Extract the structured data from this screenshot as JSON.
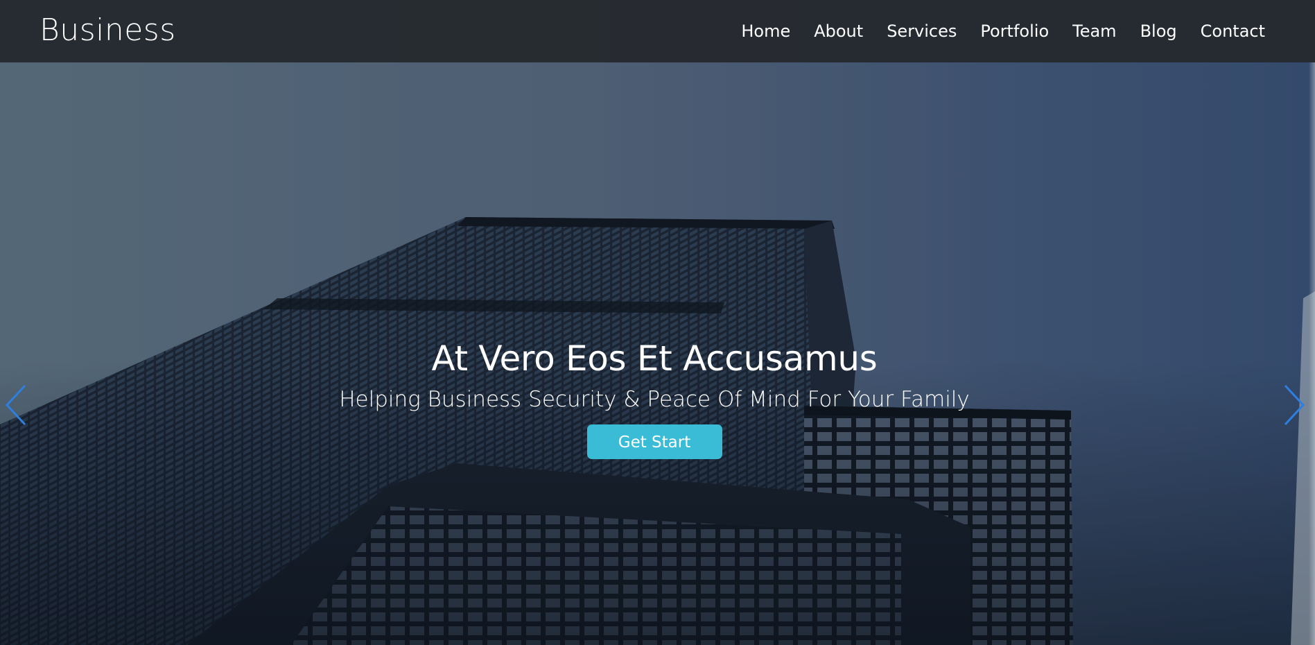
{
  "nav": {
    "brand": "Business",
    "links": [
      "Home",
      "About",
      "Services",
      "Portfolio",
      "Team",
      "Blog",
      "Contact"
    ]
  },
  "hero": {
    "title": "At Vero Eos Et Accusamus",
    "subtitle": "Helping Business Security & Peace Of Mind For Your Family",
    "cta_label": "Get Start"
  },
  "icons": {
    "prev": "chevron-left-icon",
    "next": "chevron-right-icon"
  },
  "colors": {
    "navbar_bg": "#252a2f",
    "cta_bg": "#3bbcd6",
    "arrow_color": "#2f7fe0",
    "text": "#ffffff"
  }
}
